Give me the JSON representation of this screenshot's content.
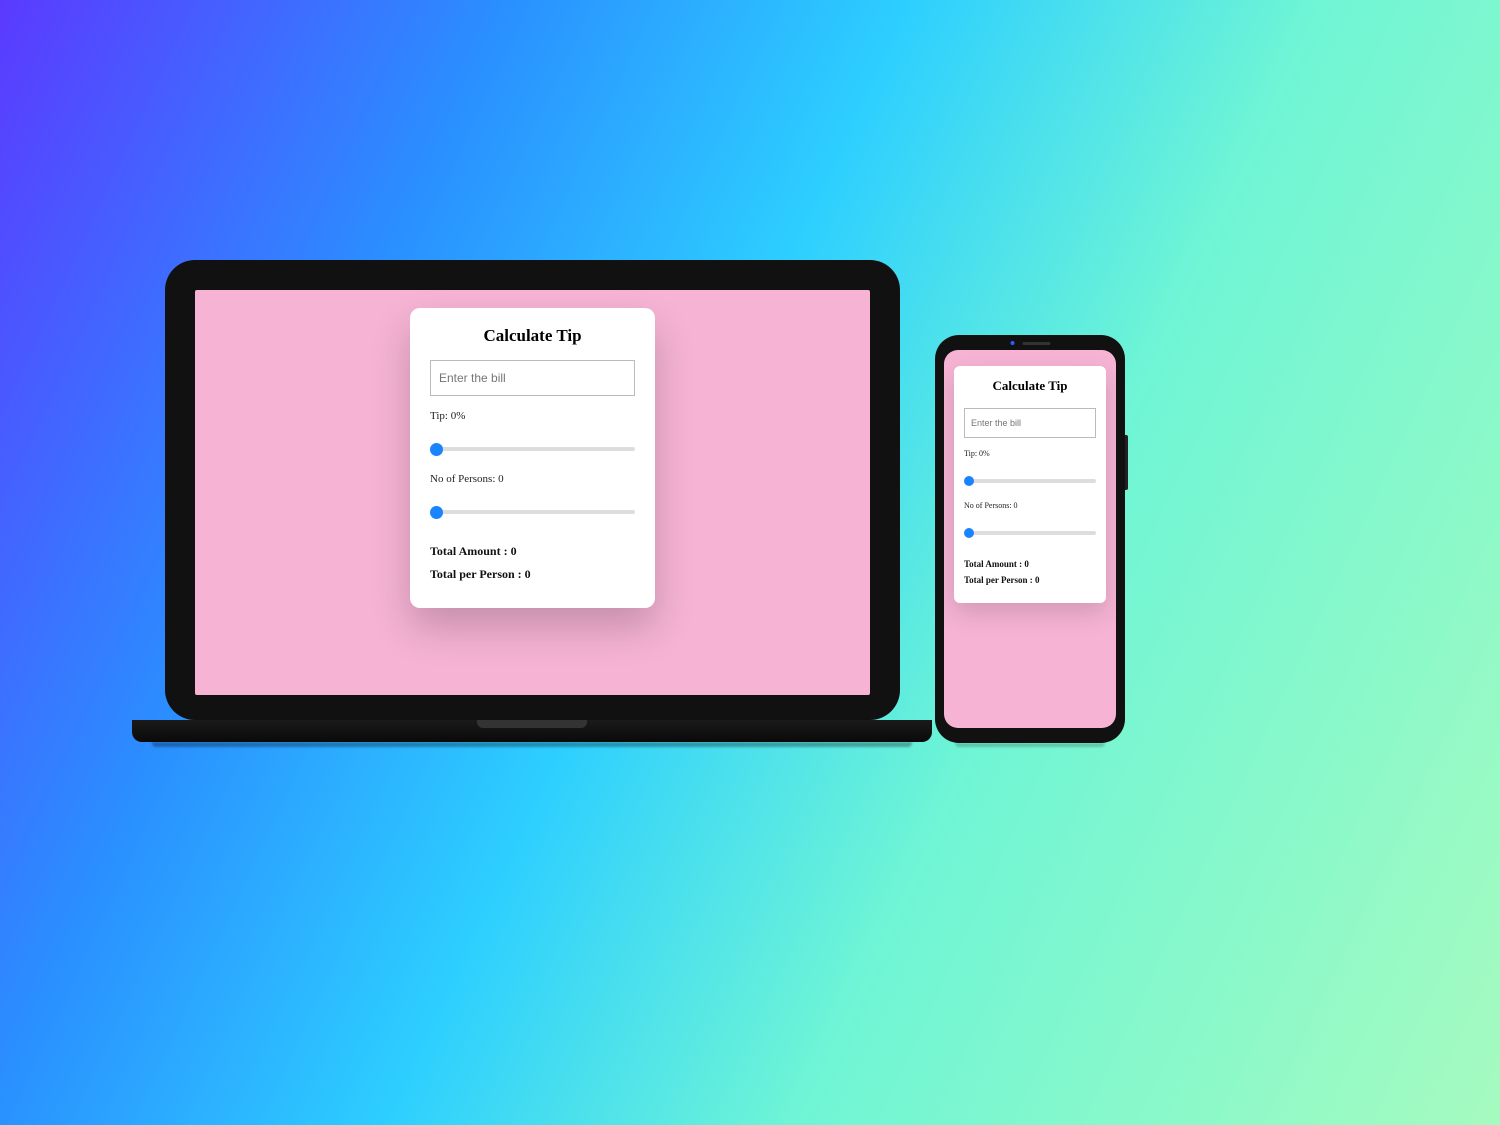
{
  "app": {
    "title": "Calculate Tip",
    "bill_placeholder": "Enter the bill",
    "tip_label": "Tip: 0%",
    "tip_value": "0",
    "persons_label": "No of Persons: 0",
    "persons_value": "0",
    "total_amount_label": "Total Amount : 0",
    "total_per_person_label": "Total per Person : 0"
  }
}
